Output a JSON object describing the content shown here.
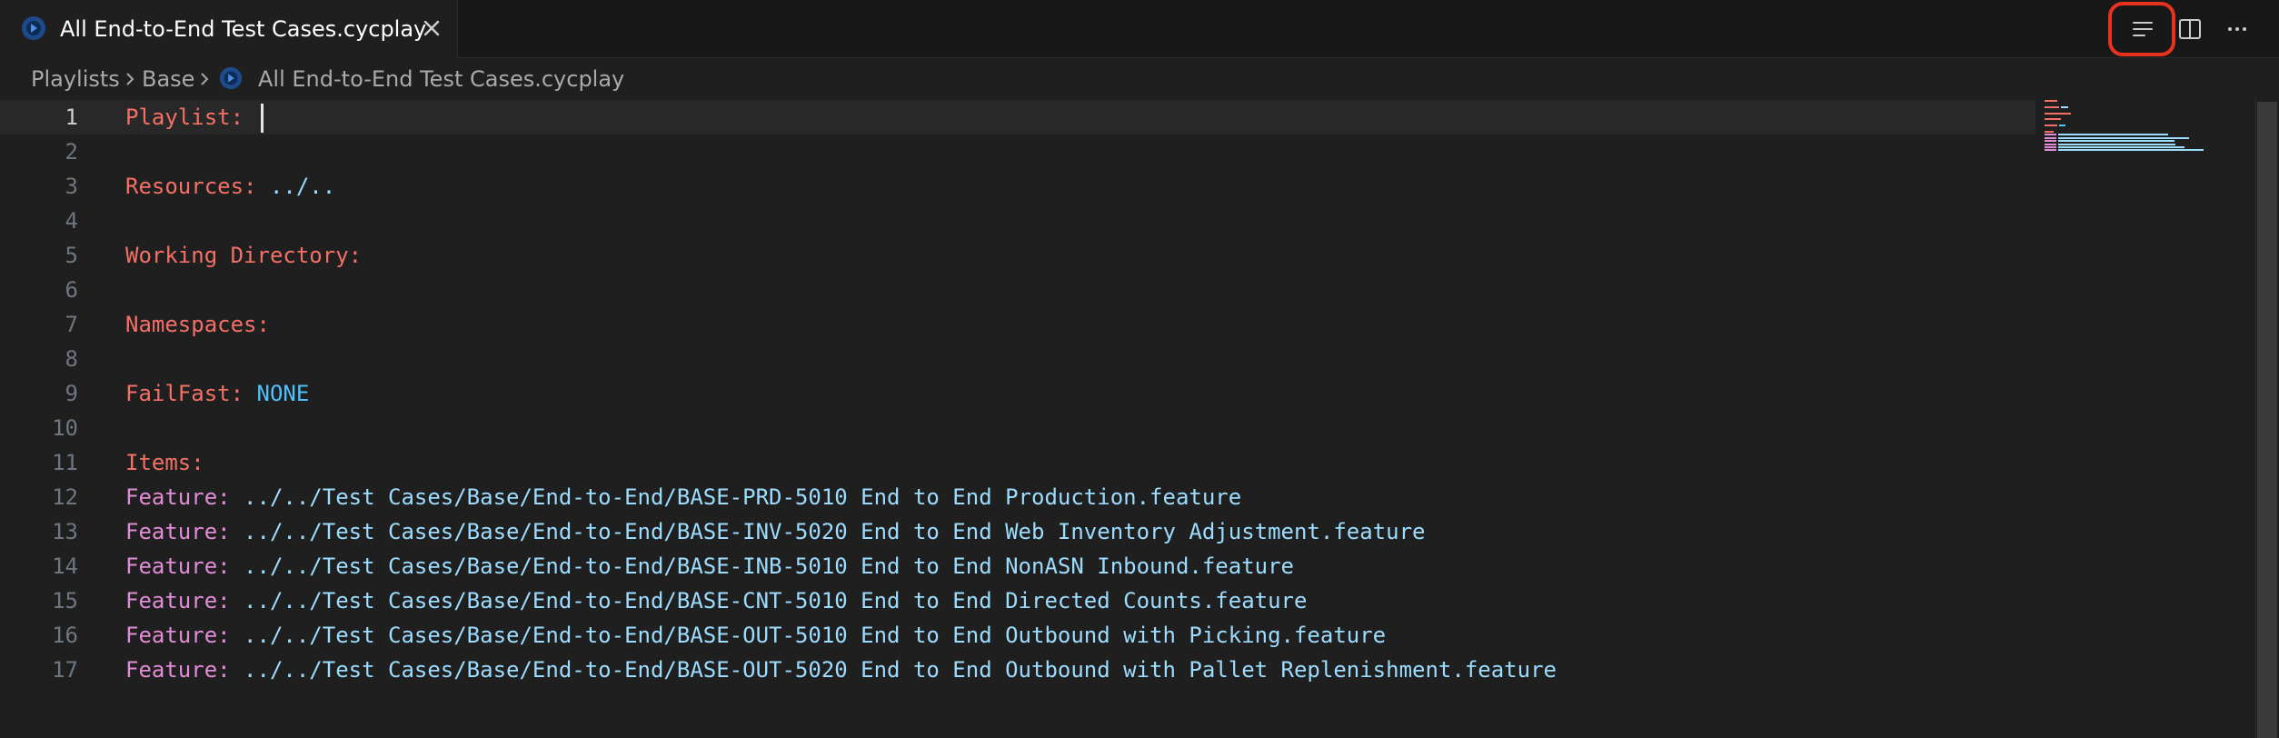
{
  "tab": {
    "title": "All End-to-End Test Cases.cycplay",
    "icon": "cycplay-file-icon",
    "close_icon": "close-icon"
  },
  "toolbar": {
    "outline_icon": "outline-list-icon",
    "split_icon": "split-editor-icon",
    "more_icon": "more-actions-icon"
  },
  "breadcrumb": {
    "items": [
      "Playlists",
      "Base",
      "All End-to-End Test Cases.cycplay"
    ]
  },
  "editor": {
    "current_line": 1,
    "lines": [
      {
        "n": "1",
        "key": "Playlist:",
        "value": ""
      },
      {
        "n": "2",
        "key": "",
        "value": ""
      },
      {
        "n": "3",
        "key": "Resources:",
        "value": "../.."
      },
      {
        "n": "4",
        "key": "",
        "value": ""
      },
      {
        "n": "5",
        "key": "Working Directory:",
        "value": ""
      },
      {
        "n": "6",
        "key": "",
        "value": ""
      },
      {
        "n": "7",
        "key": "Namespaces:",
        "value": ""
      },
      {
        "n": "8",
        "key": "",
        "value": ""
      },
      {
        "n": "9",
        "key": "FailFast:",
        "value": "NONE"
      },
      {
        "n": "10",
        "key": "",
        "value": ""
      },
      {
        "n": "11",
        "key": "Items:",
        "value": ""
      },
      {
        "n": "12",
        "key": "Feature:",
        "value": "../../Test Cases/Base/End-to-End/BASE-PRD-5010 End to End Production.feature"
      },
      {
        "n": "13",
        "key": "Feature:",
        "value": "../../Test Cases/Base/End-to-End/BASE-INV-5020 End to End Web Inventory Adjustment.feature"
      },
      {
        "n": "14",
        "key": "Feature:",
        "value": "../../Test Cases/Base/End-to-End/BASE-INB-5010 End to End NonASN Inbound.feature"
      },
      {
        "n": "15",
        "key": "Feature:",
        "value": "../../Test Cases/Base/End-to-End/BASE-CNT-5010 End to End Directed Counts.feature"
      },
      {
        "n": "16",
        "key": "Feature:",
        "value": "../../Test Cases/Base/End-to-End/BASE-OUT-5010 End to End Outbound with Picking.feature"
      },
      {
        "n": "17",
        "key": "Feature:",
        "value": "../../Test Cases/Base/End-to-End/BASE-OUT-5020 End to End Outbound with Pallet Replenishment.feature"
      }
    ]
  },
  "colors": {
    "key_red": "#f47067",
    "key_pink": "#e28cd8",
    "value_blue": "#9cdcfe",
    "value_const": "#4fc1ff",
    "highlight": "#e8321e"
  }
}
